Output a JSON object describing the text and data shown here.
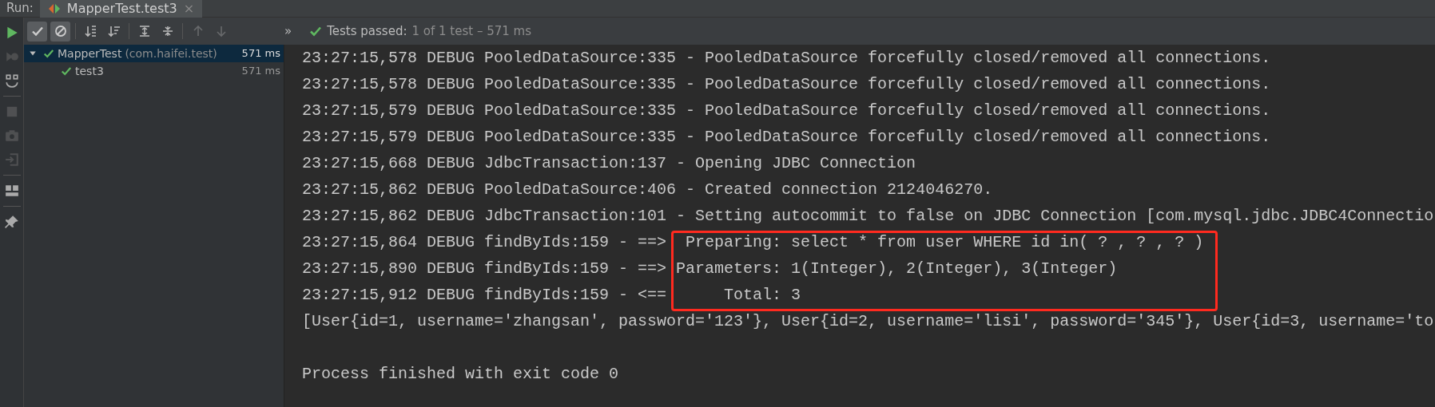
{
  "run_label": "Run:",
  "tabs": [
    {
      "label": "MapperTest.test3",
      "selected": true,
      "close": "×"
    }
  ],
  "side_tools": [
    {
      "kind": "run",
      "disabled": false
    },
    {
      "kind": "rerun-failed",
      "disabled": true
    },
    {
      "kind": "toggle",
      "disabled": false
    },
    {
      "kind": "stop",
      "disabled": true
    },
    {
      "kind": "camera",
      "disabled": true
    },
    {
      "kind": "import",
      "disabled": true
    },
    {
      "kind": "layout",
      "disabled": false
    },
    {
      "kind": "pin",
      "disabled": false
    }
  ],
  "toolbar": [
    {
      "kind": "check",
      "on": true,
      "disabled": false
    },
    {
      "kind": "ignored",
      "on": true,
      "disabled": false
    },
    {
      "kind": "sort-alpha",
      "disabled": false
    },
    {
      "kind": "sort-duration",
      "disabled": false
    },
    {
      "kind": "expand",
      "disabled": false
    },
    {
      "kind": "collapse",
      "disabled": false
    },
    {
      "kind": "up",
      "disabled": true
    },
    {
      "kind": "down",
      "disabled": true
    }
  ],
  "more": "»",
  "status": {
    "label": "Tests passed:",
    "detail": "1 of 1 test – 571 ms"
  },
  "tree": [
    {
      "name": "MapperTest",
      "package": "(com.haifei.test)",
      "time": "571 ms",
      "selected": true,
      "expanded": true,
      "children": [
        {
          "name": "test3",
          "time": "571 ms",
          "selected": false
        }
      ]
    }
  ],
  "console": [
    {
      "text": "23:27:15,578 DEBUG PooledDataSource:335 - PooledDataSource forcefully closed/removed all connections.",
      "highlighted": false
    },
    {
      "text": "23:27:15,578 DEBUG PooledDataSource:335 - PooledDataSource forcefully closed/removed all connections.",
      "highlighted": false
    },
    {
      "text": "23:27:15,579 DEBUG PooledDataSource:335 - PooledDataSource forcefully closed/removed all connections.",
      "highlighted": false
    },
    {
      "text": "23:27:15,579 DEBUG PooledDataSource:335 - PooledDataSource forcefully closed/removed all connections.",
      "highlighted": false
    },
    {
      "text": "23:27:15,668 DEBUG JdbcTransaction:137 - Opening JDBC Connection",
      "highlighted": false
    },
    {
      "text": "23:27:15,862 DEBUG PooledDataSource:406 - Created connection 2124046270.",
      "highlighted": false
    },
    {
      "text": "23:27:15,862 DEBUG JdbcTransaction:101 - Setting autocommit to false on JDBC Connection [com.mysql.jdbc.JDBC4Connectio",
      "highlighted": false
    },
    {
      "text": "23:27:15,864 DEBUG findByIds:159 - ==>  Preparing: select * from user WHERE id in( ? , ? , ? )",
      "highlighted": true
    },
    {
      "text": "23:27:15,890 DEBUG findByIds:159 - ==> Parameters: 1(Integer), 2(Integer), 3(Integer)",
      "highlighted": true
    },
    {
      "text": "23:27:15,912 DEBUG findByIds:159 - <==      Total: 3",
      "highlighted": true
    },
    {
      "text": "[User{id=1, username='zhangsan', password='123'}, User{id=2, username='lisi', password='345'}, User{id=3, username='to",
      "highlighted": false
    },
    {
      "kind": "exit",
      "text": "Process finished with exit code 0",
      "highlighted": false
    }
  ]
}
